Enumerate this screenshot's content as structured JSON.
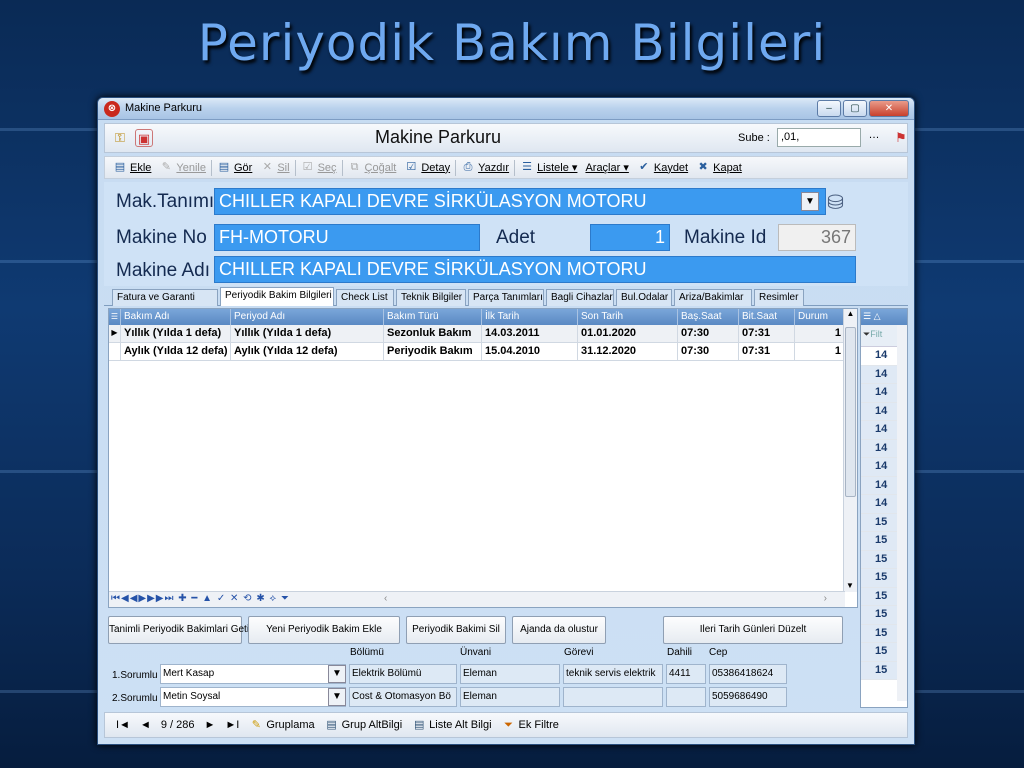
{
  "slide": {
    "title": "Periyodik Bakım Bilgileri"
  },
  "window": {
    "title": "Makine Parkuru",
    "minimize": "–",
    "maximize": "▢",
    "close": "✕"
  },
  "header": {
    "title": "Makine Parkuru",
    "sube_label": "Sube :",
    "sube_value": ",01,",
    "more": "…"
  },
  "toolbar": [
    {
      "label": "Ekle",
      "icon": "add-icon",
      "glyph": "▤",
      "enabled": true
    },
    {
      "label": "Yenile",
      "icon": "edit-icon",
      "glyph": "✎",
      "enabled": false
    },
    {
      "label": "Gör",
      "icon": "view-icon",
      "glyph": "▤",
      "enabled": true
    },
    {
      "label": "Sil",
      "icon": "delete-icon",
      "glyph": "✕",
      "enabled": false
    },
    {
      "label": "Seç",
      "icon": "select-icon",
      "glyph": "☑",
      "enabled": false
    },
    {
      "label": "Çoğalt",
      "icon": "copy-icon",
      "glyph": "⧉",
      "enabled": false
    },
    {
      "label": "Detay",
      "icon": "detail-icon",
      "glyph": "☑",
      "enabled": true
    },
    {
      "label": "Yazdır",
      "icon": "print-icon",
      "glyph": "⎙",
      "enabled": true
    },
    {
      "label": "Listele ▾",
      "icon": "list-icon",
      "glyph": "☰",
      "enabled": true
    },
    {
      "label": "Araçlar ▾",
      "icon": "",
      "glyph": "",
      "enabled": true
    },
    {
      "label": "Kaydet",
      "icon": "save-icon",
      "glyph": "✔",
      "enabled": true
    },
    {
      "label": "Kapat",
      "icon": "close-doc-icon",
      "glyph": "✖",
      "enabled": true
    }
  ],
  "form": {
    "mak_tanimi_label": "Mak.Tanımı",
    "mak_tanimi_value": "CHILLER KAPALI DEVRE SİRKÜLASYON MOTORU",
    "makine_no_label": "Makine No",
    "makine_no_value": "FH-MOTORU",
    "adet_label": "Adet",
    "adet_value": "1",
    "makine_id_label": "Makine Id",
    "makine_id_value": "367",
    "makine_adi_label": "Makine Adı",
    "makine_adi_value": "CHILLER KAPALI DEVRE SİRKÜLASYON MOTORU"
  },
  "tabs": [
    "Fatura ve Garanti",
    "Periyodik Bakim Bilgileri",
    "Check List",
    "Teknik Bilgiler",
    "Parça Tanımları",
    "Bagli Cihazlar",
    "Bul.Odalar",
    "Ariza/Bakimlar",
    "Resimler"
  ],
  "grid": {
    "columns": [
      "Bakım Adı",
      "Periyod Adı",
      "Bakım Türü",
      "İlk Tarih",
      "Son Tarih",
      "Baş.Saat",
      "Bit.Saat",
      "Durum"
    ],
    "rows": [
      [
        "Yıllık (Yılda 1 defa)",
        "Yıllık (Yılda 1 defa)",
        "Sezonluk Bakım",
        "14.03.2011",
        "01.01.2020",
        "07:30",
        "07:31",
        "1"
      ],
      [
        "Aylık (Yılda 12 defa)",
        "Aylık (Yılda 12 defa)",
        "Periyodik Bakım",
        "15.04.2010",
        "31.12.2020",
        "07:30",
        "07:31",
        "1"
      ]
    ]
  },
  "side": {
    "filter": "Filt",
    "values": [
      "14",
      "14",
      "14",
      "14",
      "14",
      "14",
      "14",
      "14",
      "14",
      "15",
      "15",
      "15",
      "15",
      "15",
      "15",
      "15",
      "15",
      "15"
    ]
  },
  "buttons": {
    "b1": "Tanimli Periyodik Bakimlari Getir",
    "b2": "Yeni Periyodik Bakim Ekle",
    "b3": "Periyodik Bakimi Sil",
    "b4": "Ajanda da olustur",
    "b5": "Ileri Tarih Günleri Düzelt"
  },
  "responsible": {
    "headers": {
      "bolum": "Bölümü",
      "unvan": "Ünvani",
      "gorev": "Görevi",
      "dahili": "Dahili",
      "cep": "Cep"
    },
    "r1": {
      "label": "1.Sorumlu",
      "name": "Mert Kasap",
      "bolum": "Elektrik Bölümü",
      "unvan": "Eleman",
      "gorev": "teknik servis elektrik",
      "dahili": "4411",
      "cep": "05386418624"
    },
    "r2": {
      "label": "2.Sorumlu",
      "name": "Metin Soysal",
      "bolum": "Cost & Otomasyon Bö",
      "unvan": "Eleman",
      "gorev": "",
      "dahili": "",
      "cep": "5059686490"
    }
  },
  "bottombar": {
    "first": "I◄",
    "prev": "◄",
    "position": "9 / 286",
    "next": "►",
    "last": "►I",
    "gruplama": "Gruplama",
    "grup_altbilgi": "Grup AltBilgi",
    "liste_alt_bilgi": "Liste Alt Bilgi",
    "ek_filtre": "Ek Filtre"
  }
}
